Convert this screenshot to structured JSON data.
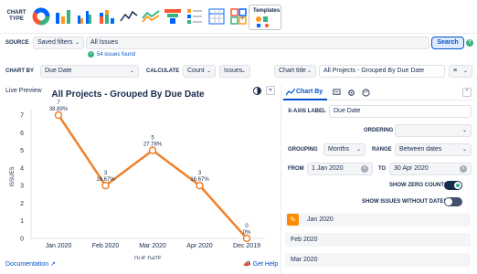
{
  "toolbar": {
    "chart_type_label": "CHART TYPE",
    "chart_types": [
      {
        "icon": "donut-chart-icon"
      },
      {
        "icon": "bar-chart-icon"
      },
      {
        "icon": "grouped-bar-chart-icon"
      },
      {
        "icon": "stacked-bar-chart-icon"
      },
      {
        "icon": "line-chart-icon"
      },
      {
        "icon": "area-chart-icon"
      },
      {
        "icon": "funnel-chart-icon"
      },
      {
        "icon": "list-chart-icon"
      },
      {
        "icon": "table-chart-icon"
      },
      {
        "icon": "kpi-tiles-icon"
      }
    ],
    "templates_label": "Templates"
  },
  "source": {
    "label": "SOURCE",
    "saved_filters": "Saved filters",
    "query": "All Issues",
    "issues_found": "54 issues found",
    "search_button": "Search"
  },
  "config": {
    "chart_by_label": "CHART BY",
    "chart_by_value": "Due Date",
    "calculate_label": "CALCULATE",
    "count_value": "Count",
    "issues_value": "Issues",
    "chart_title_select": "Chart title",
    "chart_title_value": "All Projects - Grouped By Due Date"
  },
  "preview": {
    "live_preview": "Live Preview",
    "title": "All Projects - Grouped By Due Date",
    "documentation": "Documentation",
    "get_help": "Get Help"
  },
  "chart_data": {
    "type": "line",
    "title": "All Projects - Grouped By Due Date",
    "xlabel": "DUE DATE",
    "ylabel": "ISSUES",
    "categories": [
      "Jan 2020",
      "Feb 2020",
      "Mar 2020",
      "Apr 2020",
      "Dec 2019"
    ],
    "values": [
      7,
      3,
      5,
      3,
      0
    ],
    "labels_pct": [
      "38.89%",
      "16.67%",
      "27.78%",
      "16.67%",
      "0%"
    ],
    "ylim": [
      0,
      7
    ],
    "yticks": [
      0,
      1,
      2,
      3,
      4,
      5,
      6,
      7
    ],
    "grid": false,
    "line_color": "#f0802a"
  },
  "panel": {
    "tab_chart_by": "Chart By",
    "x_axis_label": "X-AXIS LABEL",
    "x_axis_value": "Due Date",
    "ordering_label": "ORDERING",
    "grouping_label": "GROUPING",
    "grouping_value": "Months",
    "range_label": "RANGE",
    "range_value": "Between dates",
    "from_label": "FROM",
    "from_value": "1 Jan 2020",
    "to_label": "TO",
    "to_value": "30 Apr 2020",
    "show_zero_counts": "SHOW ZERO COUNTS",
    "show_issues_without_dates": "SHOW ISSUES WITHOUT DATES",
    "show_zero_counts_on": true,
    "show_issues_without_dates_on": false,
    "list_items": [
      "Jan 2020",
      "Feb 2020",
      "Mar 2020"
    ]
  },
  "colors": {
    "accent": "#0052cc",
    "orange": "#f0802a",
    "green": "#36b37e",
    "dark": "#172b4d"
  }
}
